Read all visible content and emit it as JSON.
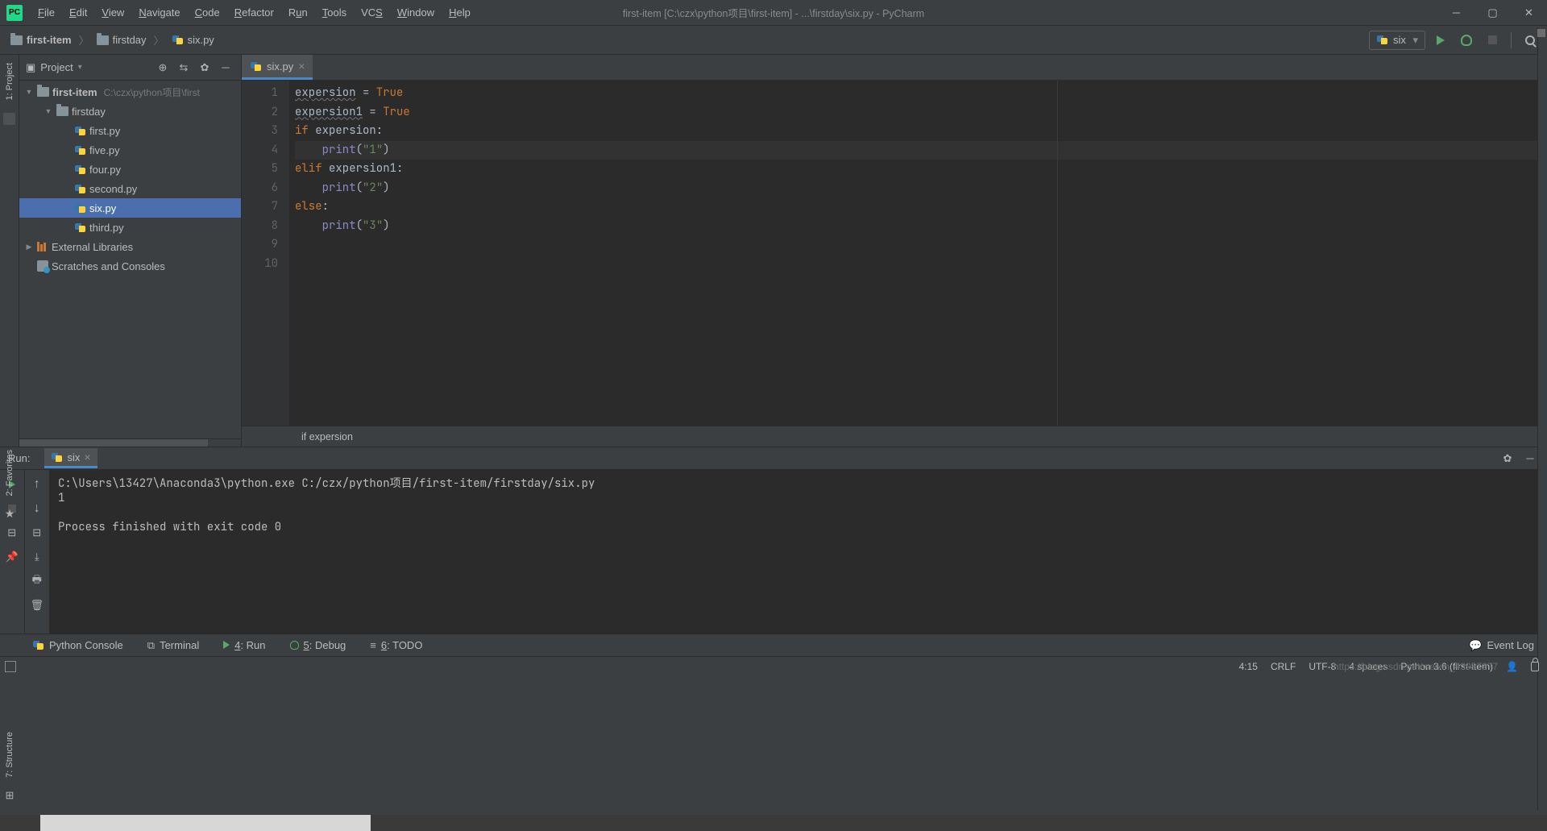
{
  "title": "first-item [C:\\czx\\python项目\\first-item] - ...\\firstday\\six.py - PyCharm",
  "menu": [
    "File",
    "Edit",
    "View",
    "Navigate",
    "Code",
    "Refactor",
    "Run",
    "Tools",
    "VCS",
    "Window",
    "Help"
  ],
  "breadcrumb": {
    "root": "first-item",
    "folder": "firstday",
    "file": "six.py"
  },
  "run_config": "six",
  "project": {
    "title": "Project",
    "root": "first-item",
    "root_path": "C:\\czx\\python项目\\first",
    "folder": "firstday",
    "files": [
      "first.py",
      "five.py",
      "four.py",
      "second.py",
      "six.py",
      "third.py"
    ],
    "ext_lib": "External Libraries",
    "scratches": "Scratches and Consoles"
  },
  "editor": {
    "tab": "six.py",
    "lines": {
      "l1_a": "expersion",
      "l1_b": " = ",
      "l1_c": "True",
      "l2_a": "expersion1",
      "l2_b": " = ",
      "l2_c": "True",
      "l3_a": "if ",
      "l3_b": "expersion:",
      "l4_a": "    ",
      "l4_b": "print",
      "l4_c": "(",
      "l4_d": "\"1\"",
      "l4_e": ")",
      "l5_a": "elif ",
      "l5_b": "expersion1:",
      "l6_a": "    ",
      "l6_b": "print",
      "l6_c": "(",
      "l6_d": "\"2\"",
      "l6_e": ")",
      "l7_a": "else",
      "l7_b": ":",
      "l8_a": "    ",
      "l8_b": "print",
      "l8_c": "(",
      "l8_d": "\"3\"",
      "l8_e": ")"
    },
    "gutter": [
      "1",
      "2",
      "3",
      "4",
      "5",
      "6",
      "7",
      "8",
      "9",
      "10"
    ],
    "context": "if expersion"
  },
  "run": {
    "title": "Run:",
    "tab": "six",
    "console": "C:\\Users\\13427\\Anaconda3\\python.exe C:/czx/python项目/first-item/firstday/six.py\n1\n\nProcess finished with exit code 0"
  },
  "bottom_tabs": {
    "console": "Python Console",
    "terminal": "Terminal",
    "run": "4: Run",
    "debug": "5: Debug",
    "todo": "6: TODO",
    "event_log": "Event Log"
  },
  "left_tools": {
    "project": "1: Project",
    "favorites": "2: Favorites",
    "structure": "7: Structure"
  },
  "status": {
    "pos": "4:15",
    "line_sep": "CRLF",
    "encoding": "UTF-8",
    "indent": "4 spaces",
    "interpreter": "Python 3.6 (first-item)",
    "watermark": "https://blog.csdn.net/weixin_43987277"
  }
}
